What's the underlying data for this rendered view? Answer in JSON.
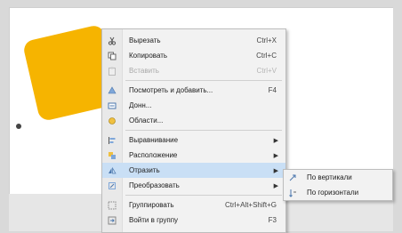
{
  "menu": {
    "items": [
      {
        "label": "Вырезать",
        "shortcut": "Ctrl+X",
        "icon": "cut-icon",
        "disabled": false
      },
      {
        "label": "Копировать",
        "shortcut": "Ctrl+C",
        "icon": "copy-icon",
        "disabled": false
      },
      {
        "label": "Вставить",
        "shortcut": "Ctrl+V",
        "icon": "paste-icon",
        "disabled": true
      },
      {
        "label": "Посмотреть и добавить...",
        "shortcut": "F4",
        "icon": "insert-icon",
        "disabled": false
      },
      {
        "label": "Донн...",
        "shortcut": "",
        "icon": "edit-icon",
        "disabled": false
      },
      {
        "label": "Области...",
        "shortcut": "",
        "icon": "area-icon",
        "disabled": false
      },
      {
        "label": "Выравнивание",
        "shortcut": "",
        "icon": "align-icon",
        "disabled": false,
        "submenu": true
      },
      {
        "label": "Расположение",
        "shortcut": "",
        "icon": "arrange-icon",
        "disabled": false,
        "submenu": true
      },
      {
        "label": "Отразить",
        "shortcut": "",
        "icon": "flip-icon",
        "disabled": false,
        "submenu": true,
        "selected": true
      },
      {
        "label": "Преобразовать",
        "shortcut": "",
        "icon": "convert-icon",
        "disabled": false,
        "submenu": true
      },
      {
        "label": "Группировать",
        "shortcut": "Ctrl+Alt+Shift+G",
        "icon": "group-icon",
        "disabled": false
      },
      {
        "label": "Войти в группу",
        "shortcut": "F3",
        "icon": "enter-group-icon",
        "disabled": false
      }
    ]
  },
  "submenu": {
    "items": [
      {
        "label": "По вертикали",
        "icon": "flip-vertical-icon"
      },
      {
        "label": "По горизонтали",
        "icon": "flip-horizontal-icon"
      }
    ]
  },
  "colors": {
    "shape": "#f6b400",
    "menu_bg": "#f2f2f2",
    "highlight": "#c9dff5"
  }
}
